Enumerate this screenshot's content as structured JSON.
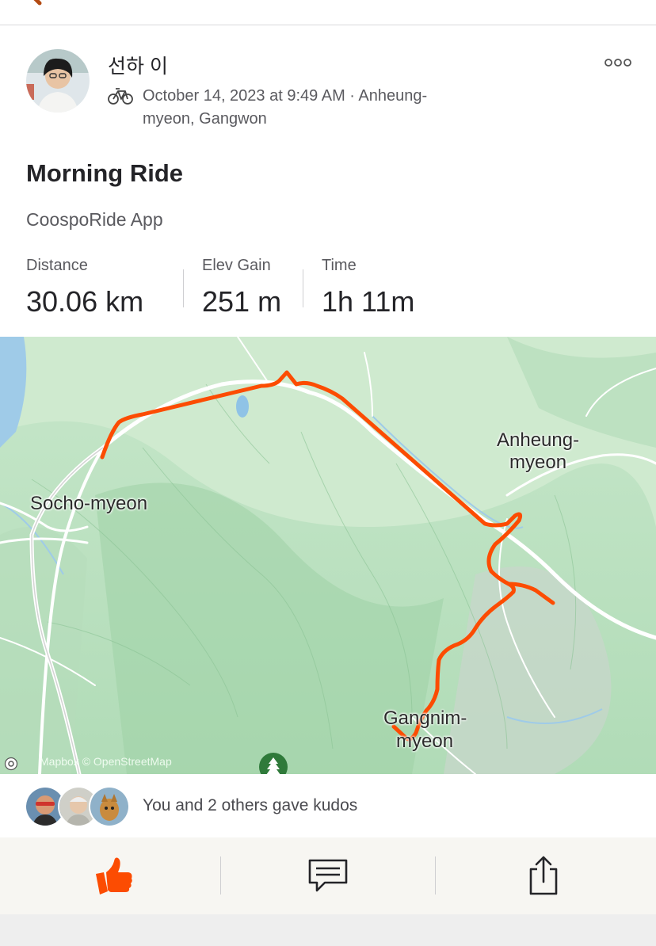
{
  "activity": {
    "athlete_name": "선하 이",
    "meta_line": "October 14, 2023 at 9:49 AM · Anheung-myeon, Gangwon",
    "title": "Morning Ride",
    "device": "CoospoRide App"
  },
  "stats": [
    {
      "label": "Distance",
      "value": "30.06 km"
    },
    {
      "label": "Elev Gain",
      "value": "251 m"
    },
    {
      "label": "Time",
      "value": "1h 11m"
    }
  ],
  "map": {
    "places": {
      "socho": "Socho-myeon",
      "anheung_1": "Anheung-",
      "anheung_2": "myeon",
      "gangnim_1": "Gangnim-",
      "gangnim_2": "myeon"
    },
    "attribution": "Mapbox © OpenStreetMap",
    "route_color": "#fc4c02"
  },
  "kudos": {
    "text": "You and 2 others gave kudos"
  },
  "icons": {
    "back": "back-arrow-icon",
    "more": "more-options-icon",
    "activity_type": "bike-icon",
    "kudos": "thumbs-up-icon",
    "comment": "comment-icon",
    "share": "share-icon"
  },
  "colors": {
    "accent": "#fc4c02",
    "text": "#242428",
    "secondary_text": "#5a5a5f"
  }
}
